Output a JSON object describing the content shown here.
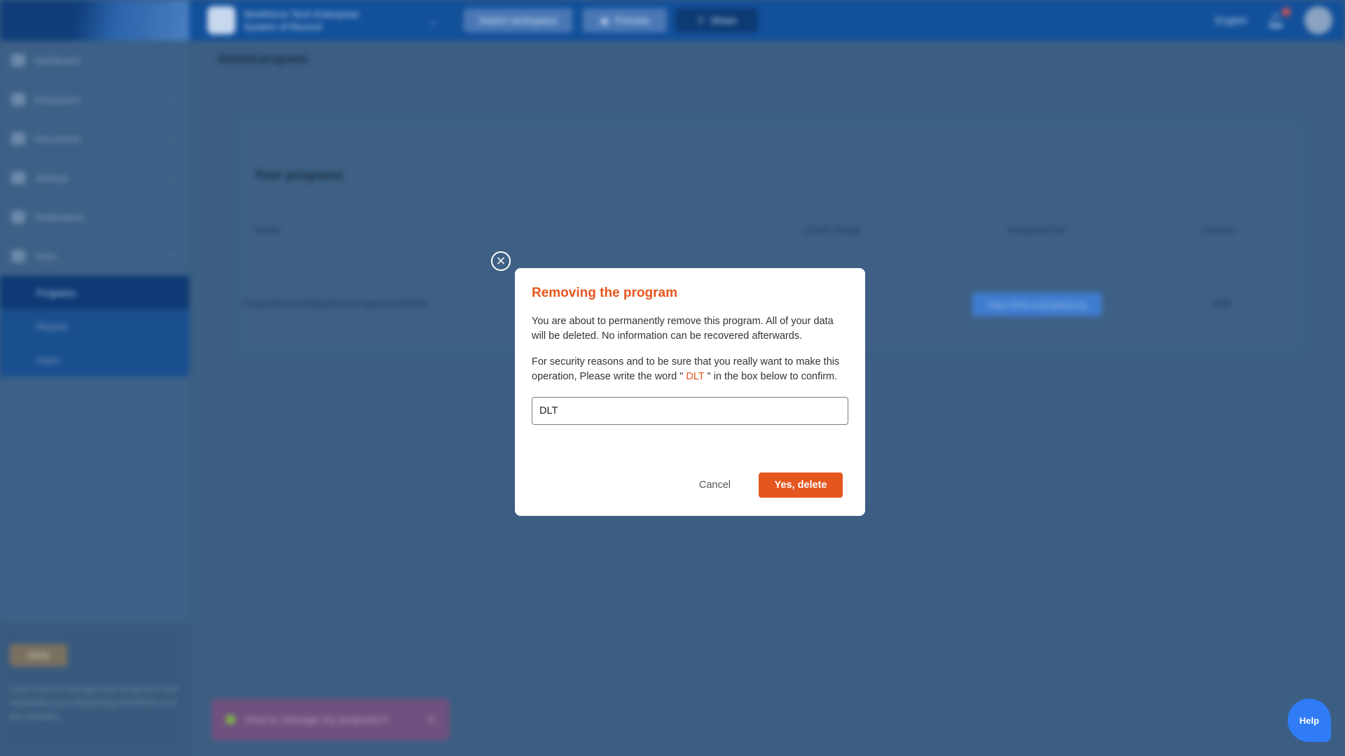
{
  "topbar": {
    "org_line1": "Workforce Tech Enterprise",
    "org_line2": "System of Record",
    "btn_switch": "Switch workspace",
    "btn_view": "Preview",
    "btn_share": "Share",
    "language": "English"
  },
  "sidebar": {
    "items": [
      {
        "label": "Dashboard"
      },
      {
        "label": "Employees"
      },
      {
        "label": "Documents"
      },
      {
        "label": "Settings"
      },
      {
        "label": "Notifications"
      },
      {
        "label": "Tools"
      }
    ],
    "sub_items": [
      {
        "label": "Programs"
      },
      {
        "label": "Reports"
      },
      {
        "label": "Users"
      }
    ],
    "promo": {
      "badge": "NEW",
      "text": "Learn how to manage your programs and automate your onboarding workflows in a few minutes."
    }
  },
  "main": {
    "page_title": "Deleted programs",
    "card_title": "Your programs",
    "columns": [
      "Name",
      "Cover image",
      "Assigned link",
      "Actions"
    ],
    "row": {
      "name": "Programme d'intégration à l'agence Bristol",
      "link": "https://link.example/prog",
      "action": "Edit"
    },
    "toast": "How to manage my programs?"
  },
  "modal": {
    "title": "Removing the program",
    "para1": "You are about to permanently remove this program. All of your data will be deleted. No information can be recovered afterwards.",
    "para2_before": "For security reasons and to be sure that you really want to make this operation, Please write the word \"",
    "para2_word": " DLT ",
    "para2_after": "\" in the box below to confirm.",
    "input_value": "DLT",
    "cancel_label": "Cancel",
    "confirm_label": "Yes, delete",
    "close_glyph": "×"
  },
  "help": {
    "label": "Help"
  },
  "colors": {
    "accent": "#e4561e",
    "primary": "#12509a",
    "help": "#2f7cf6"
  }
}
